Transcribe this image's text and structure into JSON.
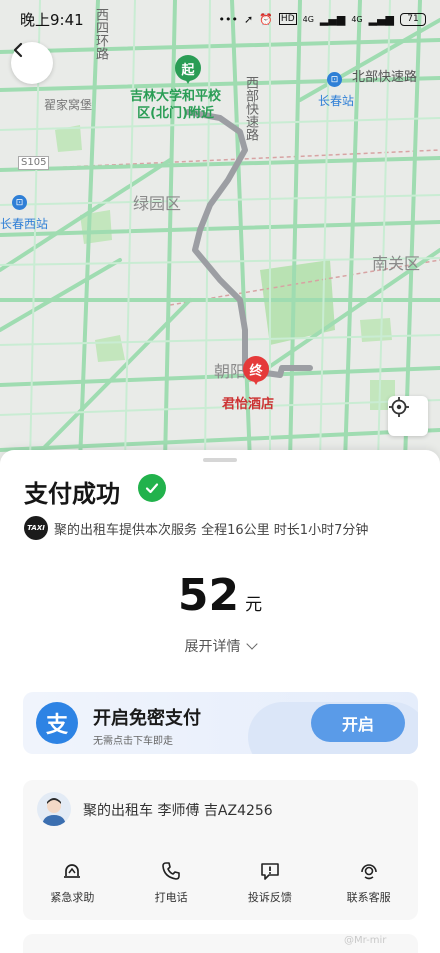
{
  "status_bar": {
    "time": "晚上9:41",
    "network_labels": [
      "HD",
      "4G",
      "4G"
    ],
    "battery": "71"
  },
  "map": {
    "roads": {
      "west_ring": "西四环路",
      "west_fast": "西部快速路",
      "north_fast": "北部快速路",
      "s105": "S105"
    },
    "areas": {
      "lvyuan": "绿园区",
      "nanguan": "南关区",
      "chaoyang": "朝阳区",
      "zhaijia": "翟家窝堡"
    },
    "stations": {
      "changchun": "长春站",
      "changchun_west": "长春西站"
    },
    "start": {
      "marker": "起",
      "label_line1": "吉林大学和平校",
      "label_line2": "区(北门)附近"
    },
    "end": {
      "marker": "终",
      "label": "君怡酒店"
    },
    "colors": {
      "road_green": "#8fd8a4",
      "route_gray": "#9c9ea3",
      "park_green": "#b5e0b0",
      "start_green": "#2a9d55",
      "end_red": "#e53a3a"
    }
  },
  "payment": {
    "title": "支付成功",
    "service_text": "聚的出租车提供本次服务 全程16公里 时长1小时7分钟",
    "taxi_badge": "TAXI",
    "amount": "52",
    "unit": "元",
    "expand_detail": "展开详情"
  },
  "promo": {
    "icon_text": "支",
    "title": "开启免密支付",
    "subtitle": "无需点击下车即走",
    "button": "开启"
  },
  "driver": {
    "info": "聚的出租车   李师傅   吉AZ4256",
    "actions": [
      "紧急求助",
      "打电话",
      "投诉反馈",
      "联系客服"
    ]
  },
  "watermark": "@Mr-mir"
}
